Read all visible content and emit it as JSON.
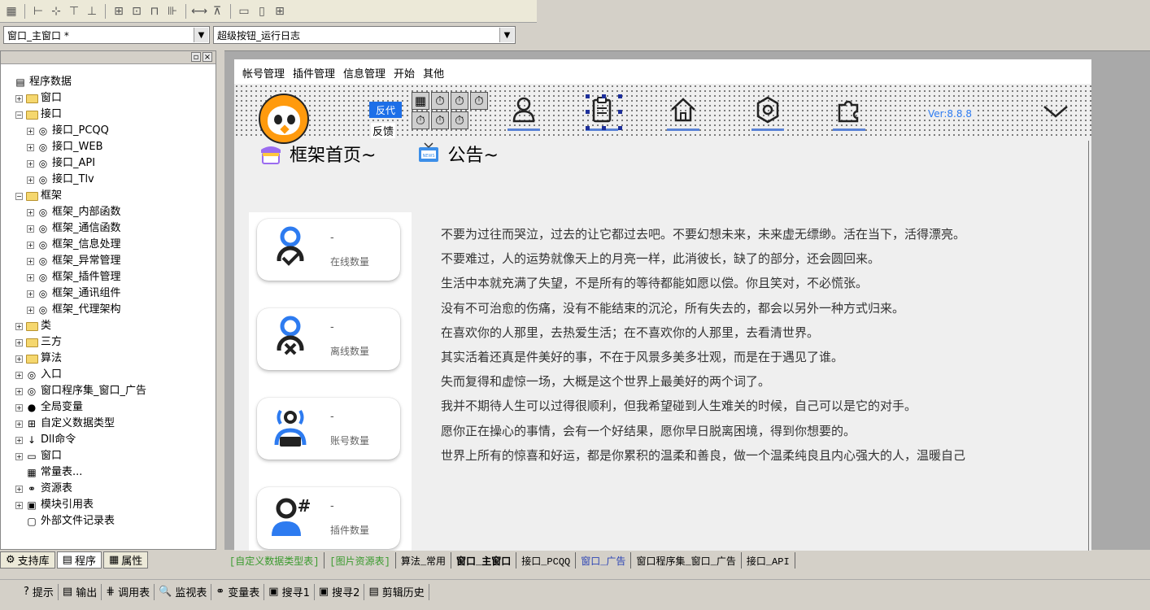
{
  "toolbar": {
    "buttons": [
      "grid-icon",
      "align-left-icon",
      "align-center-icon",
      "align-top-icon",
      "align-middle-icon",
      "center-form-icon",
      "center-h-icon",
      "space-icon",
      "equal-size-icon",
      "equal-width-icon",
      "equal-height-icon"
    ]
  },
  "combos": {
    "window_select": "窗口_主窗口 *",
    "event_select": "超级按钮_运行日志"
  },
  "tree": {
    "items": [
      {
        "label": "程序数据",
        "level": 0,
        "exp": "",
        "icon": "db"
      },
      {
        "label": "窗口",
        "level": 1,
        "exp": "+",
        "icon": "folder"
      },
      {
        "label": "接口",
        "level": 1,
        "exp": "−",
        "icon": "folder"
      },
      {
        "label": "接口_PCQQ",
        "level": 2,
        "exp": "+",
        "icon": "module"
      },
      {
        "label": "接口_WEB",
        "level": 2,
        "exp": "+",
        "icon": "module"
      },
      {
        "label": "接口_API",
        "level": 2,
        "exp": "+",
        "icon": "module"
      },
      {
        "label": "接口_Tlv",
        "level": 2,
        "exp": "+",
        "icon": "module"
      },
      {
        "label": "框架",
        "level": 1,
        "exp": "−",
        "icon": "folder"
      },
      {
        "label": "框架_内部函数",
        "level": 2,
        "exp": "+",
        "icon": "module"
      },
      {
        "label": "框架_通信函数",
        "level": 2,
        "exp": "+",
        "icon": "module"
      },
      {
        "label": "框架_信息处理",
        "level": 2,
        "exp": "+",
        "icon": "module"
      },
      {
        "label": "框架_异常管理",
        "level": 2,
        "exp": "+",
        "icon": "module"
      },
      {
        "label": "框架_插件管理",
        "level": 2,
        "exp": "+",
        "icon": "module"
      },
      {
        "label": "框架_通讯组件",
        "level": 2,
        "exp": "+",
        "icon": "module"
      },
      {
        "label": "框架_代理架构",
        "level": 2,
        "exp": "+",
        "icon": "module"
      },
      {
        "label": "类",
        "level": 1,
        "exp": "+",
        "icon": "folder"
      },
      {
        "label": "三方",
        "level": 1,
        "exp": "+",
        "icon": "folder"
      },
      {
        "label": "算法",
        "level": 1,
        "exp": "+",
        "icon": "folder"
      },
      {
        "label": "入口",
        "level": 1,
        "exp": "+",
        "icon": "module"
      },
      {
        "label": "窗口程序集_窗口_广告",
        "level": 1,
        "exp": "+",
        "icon": "module"
      },
      {
        "label": "全局变量",
        "level": 1,
        "exp": "+",
        "icon": "global"
      },
      {
        "label": "自定义数据类型",
        "level": 1,
        "exp": "+",
        "icon": "type"
      },
      {
        "label": "Dll命令",
        "level": 1,
        "exp": "+",
        "icon": "dll"
      },
      {
        "label": "窗口",
        "level": 1,
        "exp": "+",
        "icon": "window"
      },
      {
        "label": "常量表...",
        "level": 1,
        "exp": "",
        "icon": "const"
      },
      {
        "label": "资源表",
        "level": 1,
        "exp": "+",
        "icon": "res"
      },
      {
        "label": "模块引用表",
        "level": 1,
        "exp": "+",
        "icon": "modref"
      },
      {
        "label": "外部文件记录表",
        "level": 1,
        "exp": "",
        "icon": "file"
      }
    ],
    "tabs": [
      {
        "label": "支持库",
        "icon": "lib-icon"
      },
      {
        "label": "程序",
        "icon": "program-icon"
      },
      {
        "label": "属性",
        "icon": "property-icon"
      }
    ]
  },
  "form": {
    "menu": [
      "帐号管理",
      "插件管理",
      "信息管理",
      "开始",
      "其他"
    ],
    "btn_fandai": "反代",
    "btn_fankui": "反馈",
    "timer_glyph": "⏱",
    "version": "Ver:8.8.8",
    "header_home": "框架首页~",
    "header_notice": "公告~",
    "cards": [
      {
        "value": "-",
        "label": "在线数量",
        "icon": "user-check-icon"
      },
      {
        "value": "-",
        "label": "离线数量",
        "icon": "user-x-icon"
      },
      {
        "value": "-",
        "label": "账号数量",
        "icon": "account-broadcast-icon"
      },
      {
        "value": "-",
        "label": "插件数量",
        "icon": "user-hash-icon"
      }
    ],
    "notices": [
      "不要为过往而哭泣，过去的让它都过去吧。不要幻想未来，未来虚无缥缈。活在当下，活得漂亮。",
      "不要难过，人的运势就像天上的月亮一样，此消彼长，缺了的部分，还会圆回来。",
      "生活中本就充满了失望，不是所有的等待都能如愿以偿。你且笑对，不必慌张。",
      "没有不可治愈的伤痛，没有不能结束的沉沦，所有失去的，都会以另外一种方式归来。",
      "在喜欢你的人那里，去热爱生活；在不喜欢你的人那里，去看清世界。",
      "其实活着还真是件美好的事，不在于风景多美多壮观，而是在于遇见了谁。",
      "失而复得和虚惊一场，大概是这个世界上最美好的两个词了。",
      "我并不期待人生可以过得很顺利，但我希望碰到人生难关的时候，自己可以是它的对手。",
      "愿你正在操心的事情，会有一个好结果，愿你早日脱离困境，得到你想要的。",
      "世界上所有的惊喜和好运，都是你累积的温柔和善良，做一个温柔纯良且内心强大的人，温暖自己"
    ]
  },
  "doc_tabs": [
    {
      "label": "[自定义数据类型表]",
      "style": "green"
    },
    {
      "label": "[图片资源表]",
      "style": "green"
    },
    {
      "label": "算法_常用",
      "style": ""
    },
    {
      "label": "窗口_主窗口",
      "style": "active"
    },
    {
      "label": "接口_PCQQ",
      "style": ""
    },
    {
      "label": "窗口_广告",
      "style": "link"
    },
    {
      "label": "窗口程序集_窗口_广告",
      "style": ""
    },
    {
      "label": "接口_API",
      "style": ""
    }
  ],
  "output_tabs": [
    {
      "label": "提示",
      "icon": "hint-icon",
      "glyph": "?"
    },
    {
      "label": "输出",
      "icon": "output-icon",
      "glyph": "▤"
    },
    {
      "label": "调用表",
      "icon": "callstack-icon",
      "glyph": "⋕"
    },
    {
      "label": "监视表",
      "icon": "watch-icon",
      "glyph": "🔍"
    },
    {
      "label": "变量表",
      "icon": "variable-icon",
      "glyph": "⚭"
    },
    {
      "label": "搜寻1",
      "icon": "search1-icon",
      "glyph": "▣"
    },
    {
      "label": "搜寻2",
      "icon": "search2-icon",
      "glyph": "▣"
    },
    {
      "label": "剪辑历史",
      "icon": "clip-history-icon",
      "glyph": "▤"
    }
  ],
  "colors": {
    "accent_blue": "#1d6fe8",
    "nav_underline": "#5b83d6",
    "version_blue": "#2d7bf0",
    "avatar_orange": "#ff9a0d"
  }
}
